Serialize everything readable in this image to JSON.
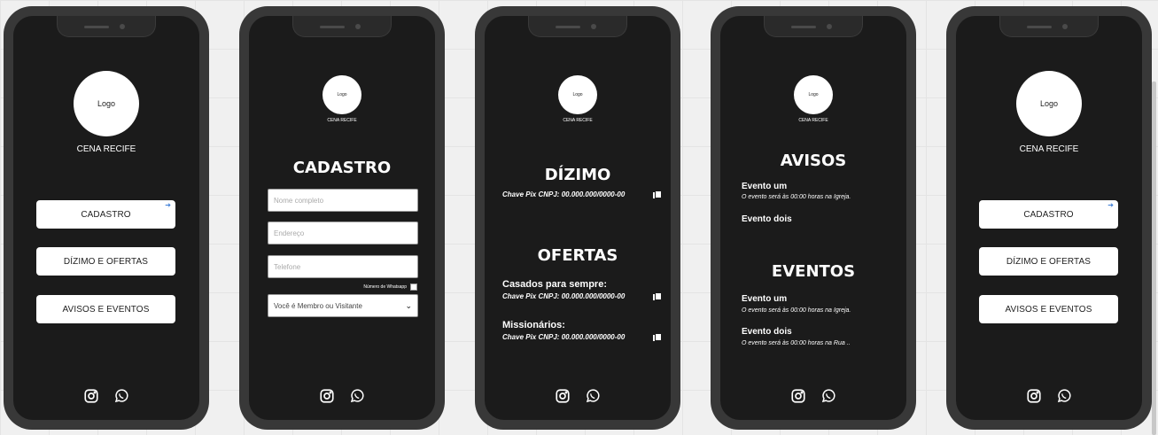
{
  "brand": {
    "logo": "Logo",
    "name": "CENA RECIFE"
  },
  "menu": [
    {
      "label": "CADASTRO",
      "icon": "arrow-up-right-icon"
    },
    {
      "label": "DÍZIMO E OFERTAS"
    },
    {
      "label": "AVISOS E EVENTOS"
    }
  ],
  "social": {
    "instagram": "instagram-icon",
    "whatsapp": "whatsapp-icon"
  },
  "cadastro": {
    "title": "CADASTRO",
    "name_placeholder": "Nome completo",
    "address_placeholder": "Endereço",
    "phone_placeholder": "Telefone",
    "whatsapp_label": "Número de Whatsapp",
    "member_select": "Você é Membro ou Visitante"
  },
  "dizimo": {
    "title": "DÍZIMO",
    "pix": "Chave Pix CNPJ:  00.000.000/0000-00",
    "ofertas_title": "OFERTAS",
    "oferta1_title": "Casados para sempre:",
    "oferta1_pix": "Chave Pix CNPJ:  00.000.000/0000-00",
    "oferta2_title": "Missionários:",
    "oferta2_pix": "Chave Pix CNPJ:  00.000.000/0000-00"
  },
  "avisos": {
    "title": "AVISOS",
    "items": [
      {
        "title": "Evento um",
        "desc": "O evento será às 00:00 horas na Igreja."
      },
      {
        "title": "Evento dois",
        "desc": ""
      }
    ],
    "eventos_title": "EVENTOS",
    "eventos": [
      {
        "title": "Evento um",
        "desc": "O evento será às 00:00 horas na Igreja."
      },
      {
        "title": "Evento dois",
        "desc": "O evento será às 00:00 horas na Rua .."
      }
    ]
  }
}
